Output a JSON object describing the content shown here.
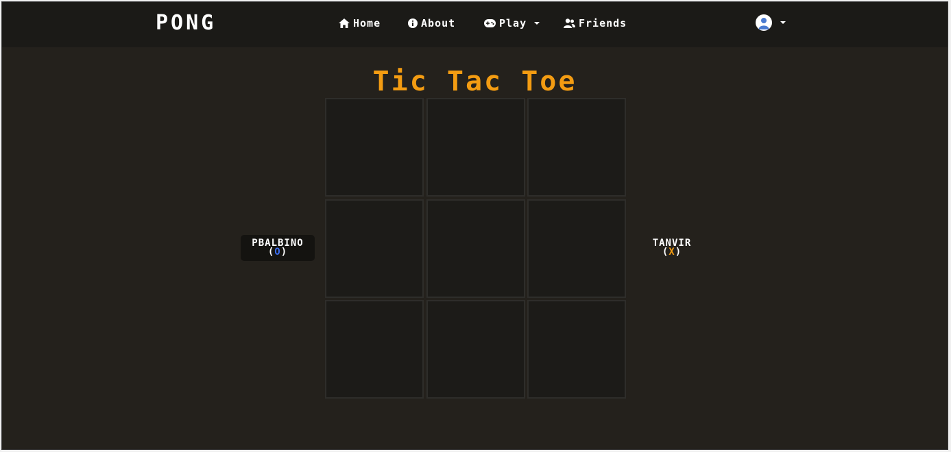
{
  "navbar": {
    "logo": "PONG",
    "items": [
      {
        "label": "Home",
        "icon": "home-icon"
      },
      {
        "label": "About",
        "icon": "info-icon"
      },
      {
        "label": "Play",
        "icon": "gamepad-icon",
        "dropdown": true
      },
      {
        "label": "Friends",
        "icon": "users-icon"
      }
    ],
    "profile": {
      "icon": "user-avatar-icon",
      "dropdown": true
    }
  },
  "game": {
    "title": "Tic Tac Toe",
    "board": [
      "",
      "",
      "",
      "",
      "",
      "",
      "",
      "",
      ""
    ],
    "players": [
      {
        "name": "PBALBINO",
        "symbol": "O",
        "active": true
      },
      {
        "name": "TANVIR",
        "symbol": "X",
        "active": false
      }
    ]
  },
  "colors": {
    "background": "#24211c",
    "navbar": "#1b1a17",
    "accent": "#f39c12",
    "player_o": "#3b6ef5",
    "player_x": "#f39c12"
  }
}
